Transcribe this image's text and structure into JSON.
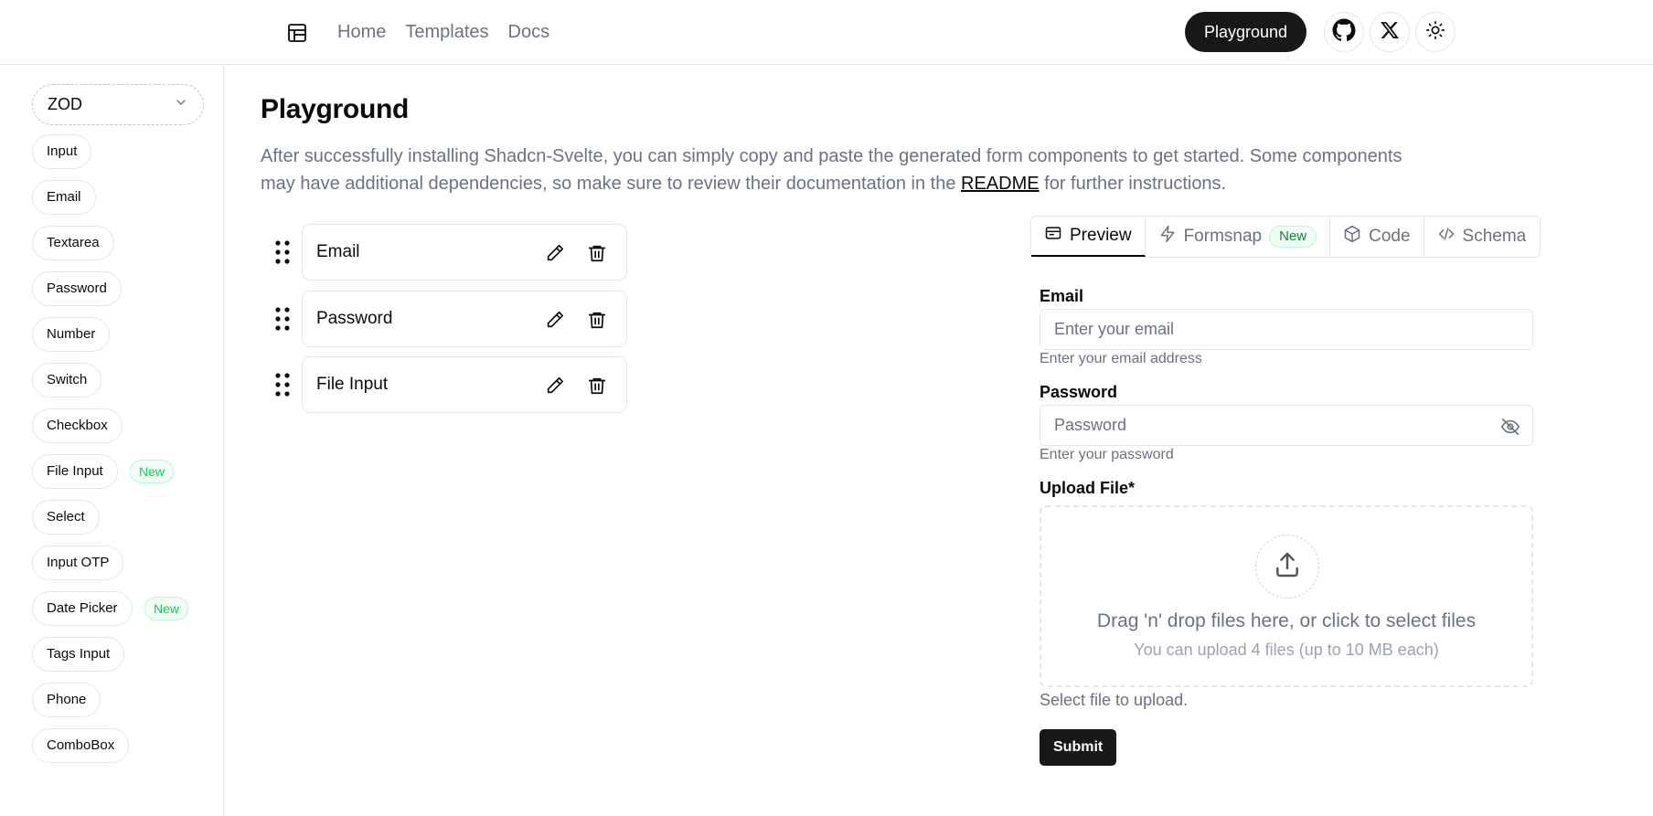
{
  "header": {
    "nav": [
      "Home",
      "Templates",
      "Docs"
    ],
    "playground_button": "Playground",
    "icons": [
      "layout-icon",
      "github-icon",
      "x-icon",
      "sun-icon"
    ]
  },
  "sidebar": {
    "library_select": "ZOD",
    "items": [
      {
        "label": "Input"
      },
      {
        "label": "Email"
      },
      {
        "label": "Textarea"
      },
      {
        "label": "Password"
      },
      {
        "label": "Number"
      },
      {
        "label": "Switch"
      },
      {
        "label": "Checkbox"
      },
      {
        "label": "File Input",
        "badge": "New"
      },
      {
        "label": "Select"
      },
      {
        "label": "Input OTP"
      },
      {
        "label": "Date Picker",
        "badge": "New"
      },
      {
        "label": "Tags Input"
      },
      {
        "label": "Phone"
      },
      {
        "label": "ComboBox"
      }
    ]
  },
  "main": {
    "title": "Playground",
    "desc_before": "After successfully installing Shadcn-Svelte, you can simply copy and paste the generated form components to get started. Some components may have additional dependencies, so make sure to review their documentation in the ",
    "desc_link": "README",
    "desc_after": " for further instructions.",
    "fields": [
      "Email",
      "Password",
      "File Input"
    ]
  },
  "tabs": {
    "preview": "Preview",
    "formsnap": "Formsnap",
    "formsnap_badge": "New",
    "code": "Code",
    "schema": "Schema"
  },
  "form": {
    "email_label": "Email",
    "email_placeholder": "Enter your email",
    "email_help": "Enter your email address",
    "password_label": "Password",
    "password_placeholder": "Password",
    "password_help": "Enter your password",
    "upload_label": "Upload File*",
    "dropzone_title": "Drag 'n' drop files here, or click to select files",
    "dropzone_sub": "You can upload 4 files (up to 10 MB each)",
    "upload_help": "Select file to upload.",
    "submit": "Submit"
  },
  "colors": {
    "primary": "#18181b",
    "muted": "#6b7280",
    "border": "#e5e7eb",
    "new_badge": "#22c55e"
  }
}
